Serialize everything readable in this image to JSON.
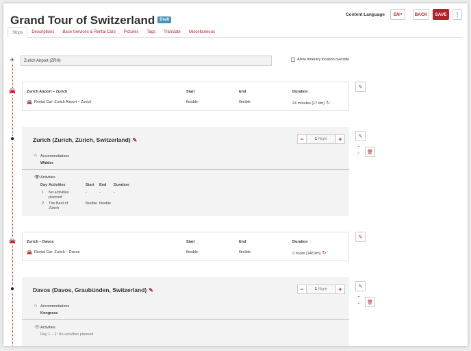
{
  "header": {
    "title": "Grand Tour of Switzerland",
    "status_badge": "Draft",
    "content_language_label": "Content Language",
    "language_value": "EN",
    "back_label": "BACK",
    "save_label": "SAVE",
    "more_label": "⋮"
  },
  "tabs": [
    {
      "label": "Stops"
    },
    {
      "label": "Descriptions"
    },
    {
      "label": "Base Services & Rental Cars"
    },
    {
      "label": "Pictures"
    },
    {
      "label": "Tags"
    },
    {
      "label": "Translate"
    },
    {
      "label": "Miscellaneous"
    }
  ],
  "start": {
    "location_value": "Zurich Airport (ZRH)",
    "override_label": "Allow itinerary location override"
  },
  "columns": {
    "start": "Start",
    "end": "End",
    "duration": "Duration"
  },
  "legs": [
    {
      "route": "Zurich Airport  – Zurich",
      "service": "Rental Car: Zurich Airport  – Zurich",
      "start": "flexible",
      "end": "flexible",
      "duration": "24 minutes (17 km)"
    },
    {
      "route": "Zurich  – Davos",
      "service": "Rental Car: Zurich  – Davos",
      "start": "flexible",
      "end": "flexible",
      "duration": "2 hours (148 km)"
    }
  ],
  "stops": [
    {
      "title": "Zurich (Zurich, Zürich, Switzerland)",
      "nights_value": "1",
      "nights_unit": "Night",
      "accommodations_label": "Accommodations",
      "accommodation": "Widder",
      "activities_label": "Activities",
      "activity_columns": {
        "day": "Day",
        "activities": "Activities",
        "start": "Start",
        "end": "End",
        "duration": "Duration"
      },
      "activities": [
        {
          "day": "1",
          "activity": "No activities planned",
          "start": "-",
          "end": "-",
          "duration": "-"
        },
        {
          "day": "2",
          "activity": "The Best of Zürich",
          "start": "flexible",
          "end": "flexible",
          "duration": ""
        }
      ]
    },
    {
      "title": "Davos (Davos, Graubünden, Switzerland)",
      "nights_value": "1",
      "nights_unit": "Night",
      "accommodations_label": "Accommodations",
      "accommodation": "Kongress",
      "activities_label": "Activities",
      "activities_summary": "Day 1 – 2: No activities planned"
    }
  ],
  "colors": {
    "accent": "#b2222a",
    "badge": "#4a90b8",
    "stop_bg": "#f3f3f3"
  }
}
